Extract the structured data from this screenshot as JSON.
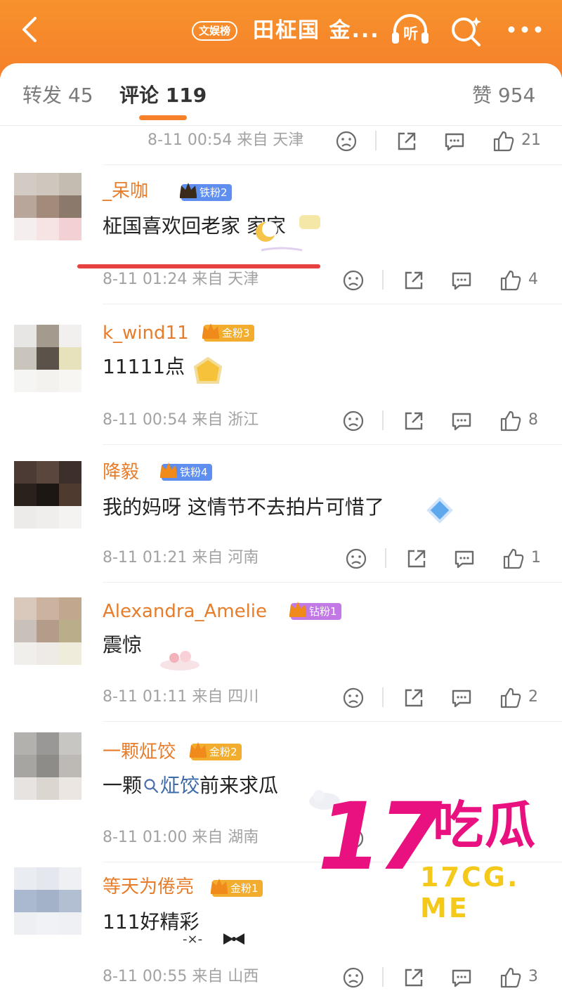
{
  "header": {
    "tag": "文娱榜",
    "title": "田柾国 金...",
    "listen_label": "听",
    "icons": [
      "back-chevron-icon",
      "headphones-icon",
      "search-sparkle-icon",
      "more-dots-icon"
    ],
    "colors": {
      "bar": "#f5852b",
      "accent": "#f7812b"
    }
  },
  "tabs": {
    "repost": "转发 45",
    "comments": "评论 119",
    "likes": "赞 954"
  },
  "top_meta": {
    "time_loc": "8-11 00:54  来自 天津",
    "likes": "21"
  },
  "comments": [
    {
      "name": "_呆咖",
      "badge": "铁粉2",
      "text": "柾国喜欢回老家 家家",
      "time_loc": "8-11 01:24  来自 天津",
      "likes": "4"
    },
    {
      "name": "k_wind11",
      "badge": "金粉3",
      "text": "11111点",
      "time_loc": "8-11 00:54  来自 浙江",
      "likes": "8"
    },
    {
      "name": "降毅",
      "badge": "铁粉4",
      "text": "我的妈呀 这情节不去拍片可惜了",
      "time_loc": "8-11 01:21  来自 河南",
      "likes": "1"
    },
    {
      "name": "Alexandra_Amelie",
      "badge": "钻粉1",
      "text": "震惊",
      "time_loc": "8-11 01:11  来自 四川",
      "likes": "2"
    },
    {
      "name": "一颗炡饺",
      "badge": "金粉2",
      "text_prefix": "一颗",
      "text_link": "炡饺",
      "text_suffix": "前来求瓜",
      "time_loc": "8-11 01:00  来自 湖南",
      "likes": ""
    },
    {
      "name": "等天为倦亮",
      "badge": "金粉1",
      "text": "111好精彩",
      "time_loc": "8-11 00:55  来自 山西",
      "likes": "3"
    }
  ],
  "watermark": {
    "big": "17",
    "cn": "吃瓜",
    "url": "17CG. ME"
  }
}
